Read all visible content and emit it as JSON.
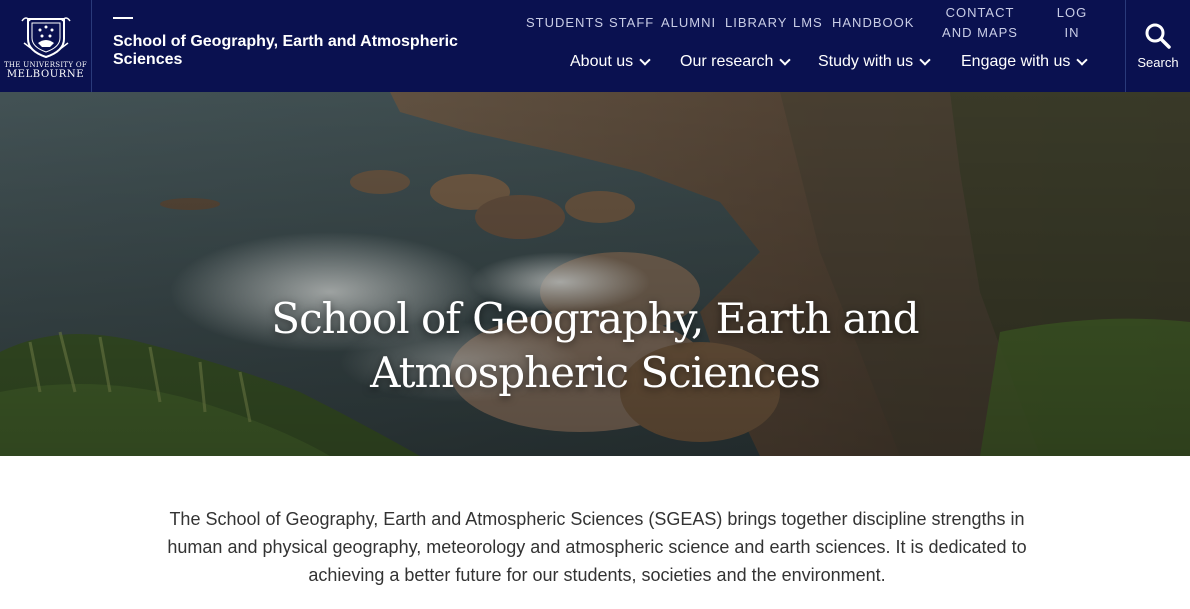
{
  "logo": {
    "line1": "THE UNIVERSITY OF",
    "line2": "MELBOURNE",
    "icon": "crest-icon"
  },
  "site": {
    "title": "School of Geography, Earth and Atmospheric Sciences"
  },
  "utility_nav": [
    {
      "label": "STUDENTS"
    },
    {
      "label": "STAFF"
    },
    {
      "label": "ALUMNI"
    },
    {
      "label": "LIBRARY"
    },
    {
      "label": "LMS"
    },
    {
      "label": "HANDBOOK"
    },
    {
      "label": "CONTACT AND MAPS"
    },
    {
      "label": "LOG IN"
    }
  ],
  "main_nav": [
    {
      "label": "About us",
      "icon": "chevron-down-icon"
    },
    {
      "label": "Our research",
      "icon": "chevron-down-icon"
    },
    {
      "label": "Study with us",
      "icon": "chevron-down-icon"
    },
    {
      "label": "Engage with us",
      "icon": "chevron-down-icon"
    }
  ],
  "search": {
    "label": "Search",
    "icon": "search-icon"
  },
  "hero": {
    "title_line1": "School of Geography, Earth and",
    "title_line2": "Atmospheric Sciences"
  },
  "intro": {
    "text": "The School of Geography, Earth and Atmospheric Sciences (SGEAS) brings together discipline strengths in human and physical geography, meteorology and atmospheric science and earth sciences. It is dedicated to achieving a better future for our students, societies and the environment."
  },
  "colors": {
    "header_bg": "#0a1150",
    "util_text": "#c9cde6"
  }
}
